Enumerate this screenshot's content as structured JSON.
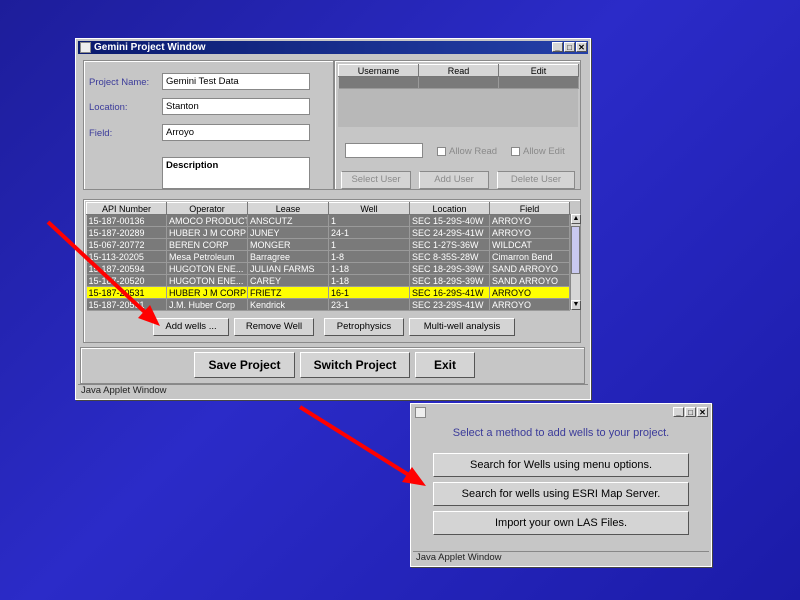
{
  "main_window": {
    "title": "Gemini Project Window",
    "controls": [
      "_",
      "□",
      "✕"
    ],
    "form": {
      "project_name_label": "Project Name:",
      "project_name_value": "Gemini Test Data",
      "location_label": "Location:",
      "location_value": "Stanton",
      "field_label": "Field:",
      "field_value": "Arroyo",
      "description_value": "Description"
    },
    "users": {
      "columns": [
        "Username",
        "Read",
        "Edit"
      ],
      "username_value": "",
      "allow_read": "Allow Read",
      "allow_edit": "Allow Edit",
      "select_user": "Select User",
      "add_user": "Add User",
      "delete_user": "Delete User"
    },
    "wells": {
      "columns": [
        "API Number",
        "Operator",
        "Lease",
        "Well",
        "Location",
        "Field"
      ],
      "rows": [
        [
          "15-187-00136",
          "AMOCO PRODUCTION",
          "ANSCUTZ",
          "1",
          "SEC 15-29S-40W",
          "ARROYO"
        ],
        [
          "15-187-20289",
          "HUBER J M CORP",
          "JUNEY",
          "24-1",
          "SEC 24-29S-41W",
          "ARROYO"
        ],
        [
          "15-067-20772",
          "BEREN CORP",
          "MONGER",
          "1",
          "SEC 1-27S-36W",
          "WILDCAT"
        ],
        [
          "15-113-20205",
          "Mesa Petroleum",
          "Barragree",
          "1-8",
          "SEC 8-35S-28W",
          "Cimarron Bend"
        ],
        [
          "15-187-20594",
          "HUGOTON ENE...",
          "JULIAN FARMS",
          "1-18",
          "SEC 18-29S-39W",
          "SAND ARROYO"
        ],
        [
          "15-187-20520",
          "HUGOTON ENE...",
          "CAREY",
          "1-18",
          "SEC 18-29S-39W",
          "SAND ARROYO"
        ],
        [
          "15-187-20531",
          "HUBER J M CORP",
          "FRIETZ",
          "16-1",
          "SEC 16-29S-41W",
          "ARROYO"
        ],
        [
          "15-187-20591",
          "J.M. Huber Corp",
          "Kendrick",
          "23-1",
          "SEC 23-29S-41W",
          "ARROYO"
        ]
      ],
      "selected_row": 6,
      "add_wells": "Add wells ...",
      "remove_well": "Remove Well",
      "petrophysics": "Petrophysics",
      "multi_well": "Multi-well analysis"
    },
    "save_project": "Save Project",
    "switch_project": "Switch Project",
    "exit": "Exit",
    "status": "Java Applet Window"
  },
  "dialog": {
    "controls": [
      "_",
      "□",
      "✕"
    ],
    "prompt": "Select a method to add wells to your project.",
    "option_menu": "Search for Wells using menu options.",
    "option_esri": "Search for wells using ESRI Map Server.",
    "option_las": "Import your own LAS Files.",
    "status": "Java Applet Window"
  },
  "colors": {
    "background": "#2323b4",
    "selected_row": "#ffff00",
    "arrow": "#ff0000",
    "label": "#3b3b9a"
  }
}
